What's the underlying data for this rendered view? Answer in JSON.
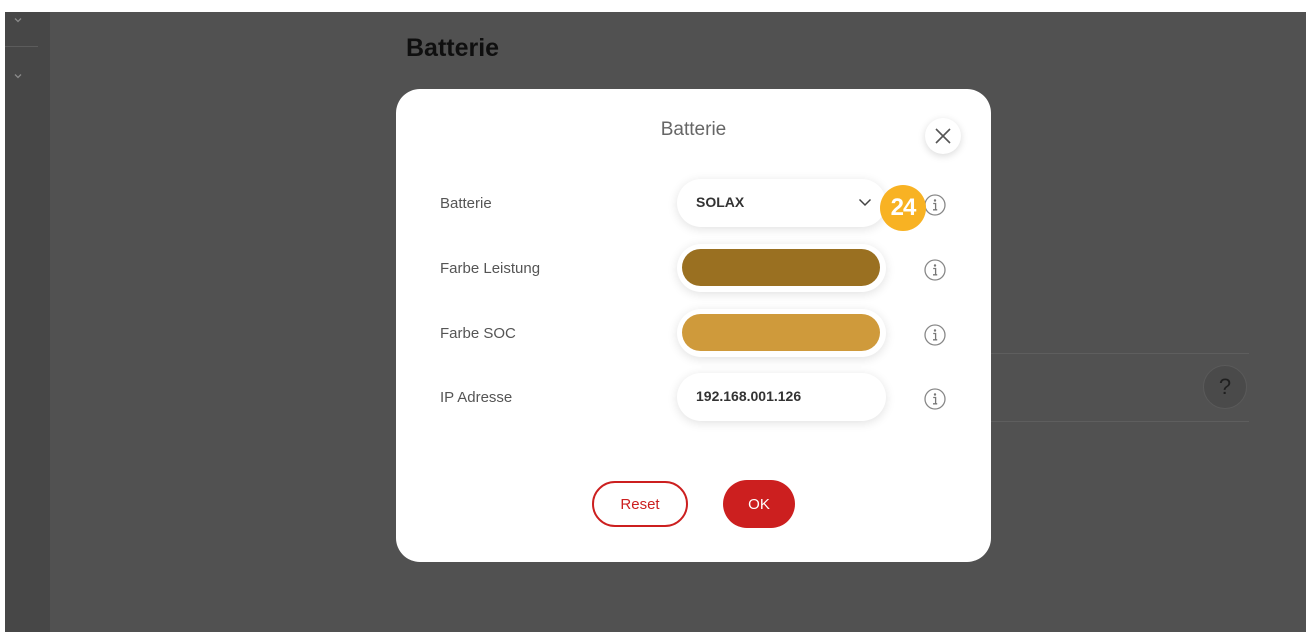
{
  "page": {
    "heading": "Batterie"
  },
  "background": {
    "help_label": "?"
  },
  "modal": {
    "title": "Batterie",
    "rows": [
      {
        "label": "Batterie",
        "value": "SOLAX",
        "type": "select"
      },
      {
        "label": "Farbe Leistung",
        "type": "color",
        "color": "#9a7021"
      },
      {
        "label": "Farbe SOC",
        "type": "color",
        "color": "#cf9a3b"
      },
      {
        "label": "IP Adresse",
        "value": "192.168.001.126",
        "type": "text"
      }
    ],
    "step_badge": "24",
    "reset_label": "Reset",
    "ok_label": "OK"
  },
  "colors": {
    "accent": "#cc1f1f",
    "badge": "#f8b223",
    "overlay": "#515151"
  }
}
